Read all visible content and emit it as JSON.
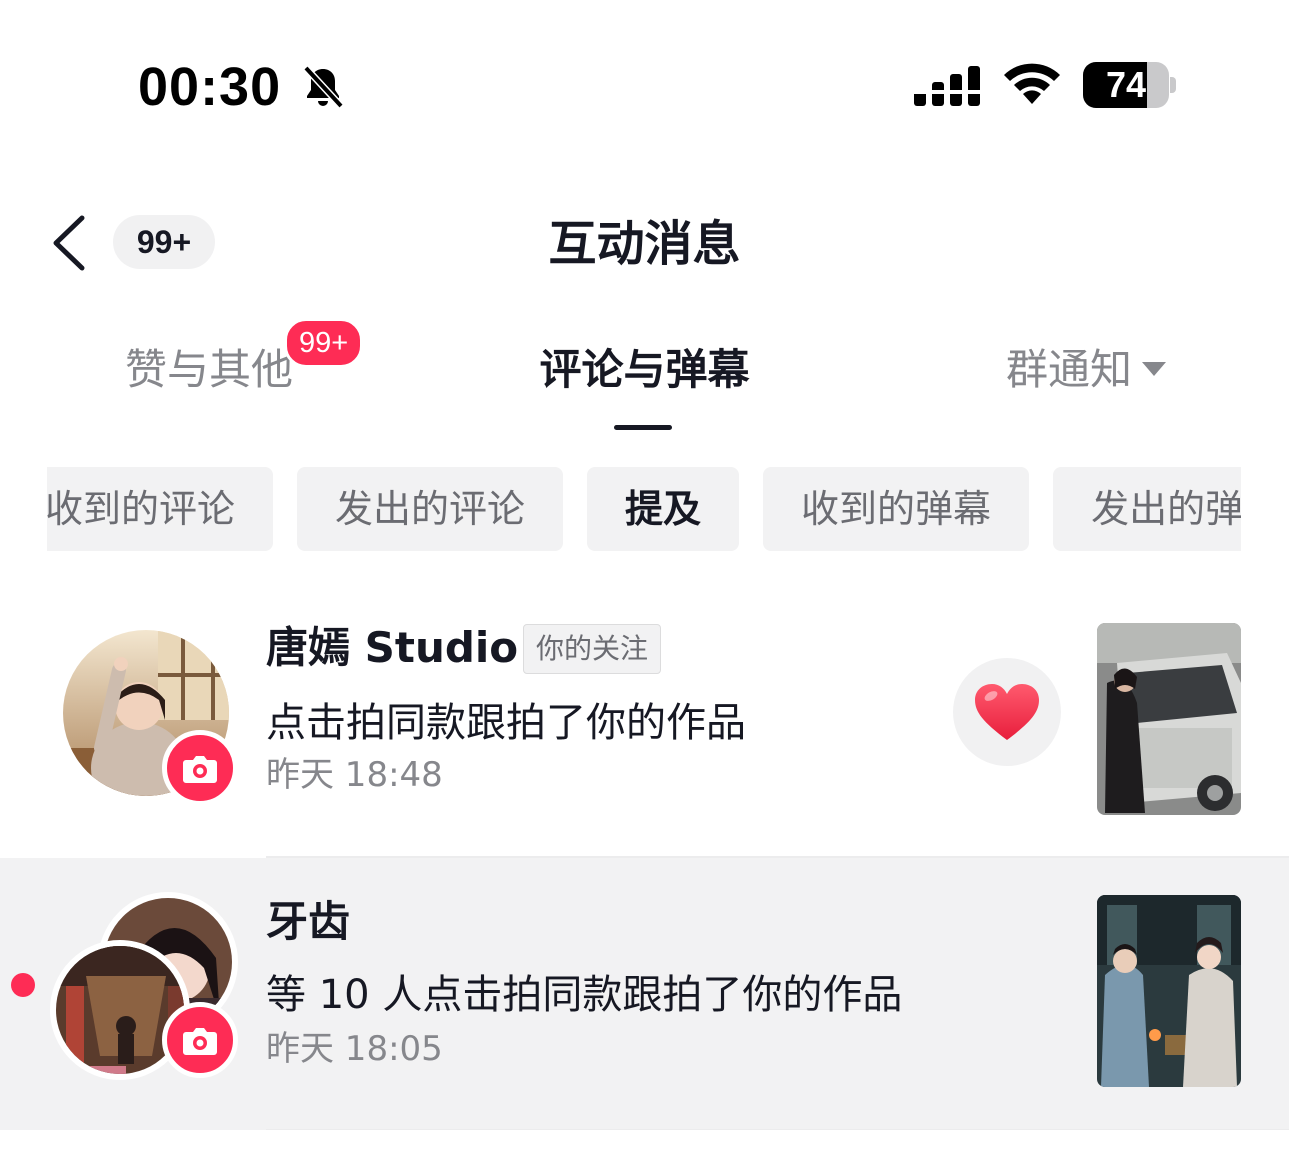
{
  "status_bar": {
    "time": "00:30",
    "battery_percent": "74",
    "battery_level": 0.74,
    "icons": [
      "bell-slash-icon",
      "cellular-signal-icon",
      "wifi-icon",
      "battery-icon"
    ]
  },
  "header": {
    "back_badge": "99+",
    "title": "互动消息"
  },
  "tabs": {
    "items": [
      {
        "label": "赞与其他",
        "badge": "99+"
      },
      {
        "label": "评论与弹幕",
        "active": true
      },
      {
        "label": "群通知"
      }
    ]
  },
  "chips": {
    "items": [
      "收到的评论",
      "发出的评论",
      "提及",
      "收到的弹幕",
      "发出的弹幕"
    ],
    "active": "提及"
  },
  "notifications": [
    {
      "username": "唐嫣 Studio",
      "tag": "你的关注",
      "action": "点击拍同款跟拍了你的作品",
      "time": "昨天 18:48",
      "liked": true,
      "unread": false
    },
    {
      "username": "牙齿",
      "action": "等 10 人点击拍同款跟拍了你的作品",
      "time": "昨天 18:05",
      "unread": true
    }
  ],
  "colors": {
    "accent": "#fe2c55",
    "text_primary": "#161823",
    "text_secondary": "#86878c",
    "chip_bg": "#f2f2f3"
  }
}
